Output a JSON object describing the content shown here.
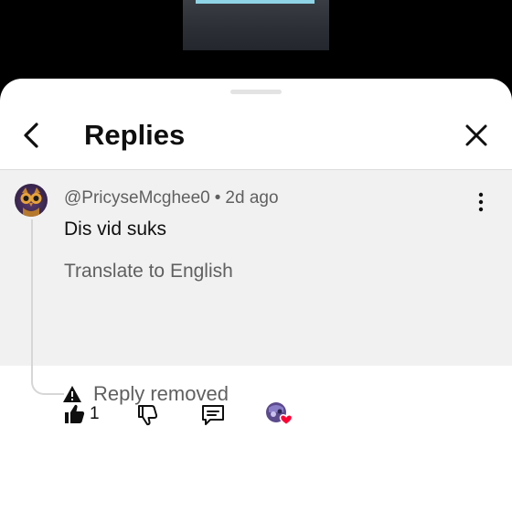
{
  "header": {
    "title": "Replies"
  },
  "comment": {
    "author": "@PricyseMcghee0",
    "separator": "•",
    "time": "2d ago",
    "text": "Dis vid suks",
    "translate_label": "Translate to English",
    "like_count": "1"
  },
  "reply": {
    "removed_label": "Reply removed"
  },
  "icons": {
    "back": "chevron-left-icon",
    "close": "close-icon",
    "more": "more-vertical-icon",
    "like": "thumbs-up-icon",
    "dislike": "thumbs-down-icon",
    "reply": "comment-icon",
    "creator_heart": "creator-heart-icon",
    "warning": "warning-icon"
  },
  "colors": {
    "comment_bg": "#f1f1f1",
    "sheet_bg": "#ffffff",
    "heart": "#ff0033",
    "secondary_text": "#606060"
  }
}
